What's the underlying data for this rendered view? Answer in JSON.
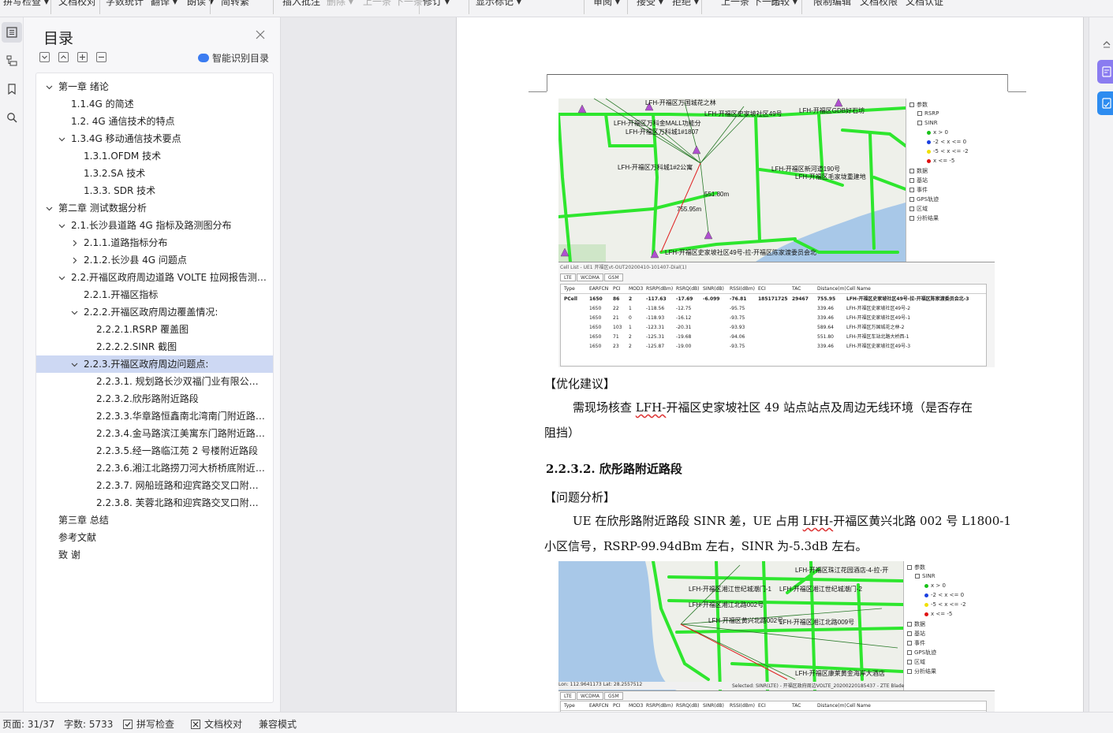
{
  "ribbon": {
    "items": [
      {
        "label": "拼写检查 ▾",
        "dim": false
      },
      {
        "label": "文档校对",
        "dim": false
      },
      {
        "label": "字数统计",
        "dim": false
      },
      {
        "label": "翻译 ▾",
        "dim": false
      },
      {
        "label": "朗读 ▾",
        "dim": false
      },
      {
        "label": "简转繁",
        "dim": false
      },
      {
        "label": "插入批注",
        "dim": false
      },
      {
        "label": "删除 ▾",
        "dim": true
      },
      {
        "label": "上一条",
        "dim": true
      },
      {
        "label": "下一条",
        "dim": true
      },
      {
        "label": "修订 ▾",
        "dim": false
      },
      {
        "label": "显示标记 ▾",
        "dim": false
      },
      {
        "label": "审阅 ▾",
        "dim": false
      },
      {
        "label": "接受 ▾",
        "dim": false
      },
      {
        "label": "拒绝 ▾",
        "dim": false
      },
      {
        "label": "上一条",
        "dim": false
      },
      {
        "label": "下一条",
        "dim": false
      },
      {
        "label": "比较 ▾",
        "dim": false
      },
      {
        "label": "限制编辑",
        "dim": false
      },
      {
        "label": "文档权限",
        "dim": false
      },
      {
        "label": "文档认证",
        "dim": false
      }
    ]
  },
  "rail": {
    "icons": [
      "toc-icon",
      "outline-icon",
      "bookmark-icon",
      "find-icon"
    ]
  },
  "toc": {
    "title": "目录",
    "smart_label": "智能识别目录",
    "items": [
      {
        "text": "第一章  绪论",
        "level": 0,
        "arrow": "down"
      },
      {
        "text": "1.1.4G 的简述",
        "level": 1,
        "arrow": ""
      },
      {
        "text": "1.2.  4G 通信技术的特点",
        "level": 1,
        "arrow": ""
      },
      {
        "text": "1.3.4G 移动通信技术要点",
        "level": 1,
        "arrow": "down"
      },
      {
        "text": "1.3.1.OFDM 技术",
        "level": 2,
        "arrow": ""
      },
      {
        "text": "1.3.2.SA 技术",
        "level": 2,
        "arrow": ""
      },
      {
        "text": "1.3.3.  SDR 技术",
        "level": 2,
        "arrow": ""
      },
      {
        "text": "第二章  测试数据分析",
        "level": 0,
        "arrow": "down"
      },
      {
        "text": "2.1.长沙县道路 4G 指标及路测图分布",
        "level": 1,
        "arrow": "down"
      },
      {
        "text": "2.1.1.道路指标分布",
        "level": 2,
        "arrow": "right"
      },
      {
        "text": "2.1.2.长沙县 4G 问题点",
        "level": 2,
        "arrow": "right"
      },
      {
        "text": "2.2.开福区政府周边道路 VOLTE 拉网报告测试...",
        "level": 1,
        "arrow": "down"
      },
      {
        "text": "2.2.1.开福区指标",
        "level": 2,
        "arrow": ""
      },
      {
        "text": "2.2.2.开福区政府周边覆盖情况:",
        "level": 2,
        "arrow": "down"
      },
      {
        "text": "2.2.2.1.RSRP 覆盖图",
        "level": 3,
        "arrow": ""
      },
      {
        "text": "2.2.2.2.SINR 截图",
        "level": 3,
        "arrow": ""
      },
      {
        "text": "2.2.3.开福区政府周边问题点:",
        "level": 2,
        "arrow": "down",
        "selected": true
      },
      {
        "text": "2.2.3.1.  规划路长沙双福门业有限公司...",
        "level": 3,
        "arrow": ""
      },
      {
        "text": "2.2.3.2.欣彤路附近路段",
        "level": 3,
        "arrow": ""
      },
      {
        "text": "2.2.3.3.华章路恒鑫南北湾南门附近路段...",
        "level": 3,
        "arrow": ""
      },
      {
        "text": "2.2.3.4.金马路滨江美寓东门路附近路段...",
        "level": 3,
        "arrow": ""
      },
      {
        "text": "2.2.3.5.经一路临江苑 2 号楼附近路段",
        "level": 3,
        "arrow": ""
      },
      {
        "text": "2.2.3.6.湘江北路捞刀河大桥桥底附近路段...",
        "level": 3,
        "arrow": ""
      },
      {
        "text": "2.2.3.7.  网船班路和迎宾路交叉口附近路段...",
        "level": 3,
        "arrow": ""
      },
      {
        "text": "2.2.3.8.  芙蓉北路和迎宾路交叉口附近路段...",
        "level": 3,
        "arrow": ""
      },
      {
        "text": "第三章  总结",
        "level": 0,
        "arrow": ""
      },
      {
        "text": "参考文献",
        "level": 0,
        "arrow": ""
      },
      {
        "text": "致    谢",
        "level": 0,
        "arrow": ""
      }
    ]
  },
  "doc": {
    "section_label": "【优化建议】",
    "suggestion_line1_pre": "需现场核查",
    "suggestion_line1_underline": "LFH-",
    "suggestion_line1_post": "开福区史家坡社区 49 站点站点及周边无线环境（是否存在",
    "suggestion_line2": "阻挡）",
    "heading": "2.2.3.2.   欣彤路附近路段",
    "analysis_label": "【问题分析】",
    "analysis_line1_pre": "UE 在欣彤路附近路段 SINR 差，UE 占用 ",
    "analysis_line1_underline": "LFH-",
    "analysis_line1_post": "开福区黄兴北路 002 号 L1800-1",
    "analysis_line2": "小区信号，RSRP-99.94dBm 左右，SINR 为-5.3dB 左右。"
  },
  "figure1": {
    "map_labels": [
      "LFH-开福区万国城花之林",
      "LFH-开福区史家坡社区49号",
      "LFH-开福区GDB好石坊",
      "LFH-开福区万科金MALL功能分",
      "LFH-开福区万科城1#1807",
      "LFH-开福区万科城1#2公寓",
      "LFH-开福区新河道190号",
      "LFH-开福区毛家垅重建地",
      "LFH-开福区史家坡社区49号-拉-开福区陈家渡委员会北",
      "755.95m",
      "551.80m"
    ],
    "legend": {
      "root": "参数",
      "items": [
        "RSRP",
        "SINR"
      ],
      "ranges": [
        {
          "label": "x > 0",
          "color": "#19c219"
        },
        {
          "label": "-2 < x <= 0",
          "color": "#1a3fe0"
        },
        {
          "label": "-5 < x <= -2",
          "color": "#f0e000"
        },
        {
          "label": "x <= -5",
          "color": "#e01010"
        }
      ],
      "groups": [
        "数据",
        "基站",
        "事件",
        "GPS轨迹",
        "区域",
        "分析结果"
      ]
    },
    "panel_title": "Cell List - UE1 开福区vt-OUT20200410-101407-Dial(1)",
    "tabs": [
      "LTE",
      "WCDMA",
      "GSM"
    ],
    "columns": [
      "Type",
      "EARFCN",
      "PCI",
      "MOD3",
      "RSRP(dBm)",
      "RSRQ(dB)",
      "SINR(dB)",
      "RSSI(dBm)",
      "ECI",
      "TAC",
      "Distance(m)",
      "Cell Name"
    ],
    "rows": [
      [
        "PCell",
        "1650",
        "86",
        "2",
        "-117.63",
        "-17.69",
        "-6.099",
        "-76.81",
        "185171725",
        "29467",
        "755.95",
        "LFH-开福区史家坡社区49号-拉-开福区陈家渡委员会北-3"
      ],
      [
        "",
        "1650",
        "22",
        "1",
        "-118.56",
        "-12.75",
        "",
        "-95.75",
        "",
        "",
        "339.46",
        "LFH-开福区史家坡社区49号-2"
      ],
      [
        "",
        "1650",
        "21",
        "0",
        "-118.93",
        "-16.12",
        "",
        "-93.75",
        "",
        "",
        "339.46",
        "LFH-开福区史家坡社区49号-1"
      ],
      [
        "",
        "1650",
        "103",
        "1",
        "-123.31",
        "-20.31",
        "",
        "-93.93",
        "",
        "",
        "589.64",
        "LFH-开福区万国城花之林-2"
      ],
      [
        "",
        "1650",
        "71",
        "2",
        "-125.31",
        "-19.68",
        "",
        "-94.06",
        "",
        "",
        "551.80",
        "LFH-开福区车站北路大桥西-1"
      ],
      [
        "",
        "1650",
        "23",
        "2",
        "-125.87",
        "-19.00",
        "",
        "-93.75",
        "",
        "",
        "339.46",
        "LFH-开福区史家坡社区49号-3"
      ]
    ]
  },
  "figure2": {
    "map_labels": [
      "LFH-开福区珠江花园酒店-4-拉-开",
      "LFH-开福区湘江世纪城潮门-1",
      "LFH-开福区湘江世纪城潮门-2",
      "LFH-开福区湘江北路002号",
      "LFH-开福区黄兴北路002号",
      "LFH-开福区湘江北路009号",
      "LFH-开福区康莱黄金海岸大酒店"
    ],
    "legend": {
      "root": "参数",
      "items": [
        "SINR"
      ],
      "ranges": [
        {
          "label": "x > 0",
          "color": "#19c219"
        },
        {
          "label": "-2 < x <= 0",
          "color": "#1a3fe0"
        },
        {
          "label": "-5 < x <= -2",
          "color": "#f0e000"
        },
        {
          "label": "x <= -5",
          "color": "#e01010"
        }
      ],
      "groups": [
        "数据",
        "基站",
        "事件",
        "GPS轨迹",
        "区域",
        "分析结果"
      ]
    },
    "status_text": "Lon:  112.9641173   Lat:  28.2557512",
    "selected_text": "Selected: SINR(LTE) - 开福区政府周边VOLTE_20200220185437 - ZTE Blade",
    "tabs": [
      "LTE",
      "WCDMA",
      "GSM"
    ],
    "columns": [
      "Type",
      "EARFCN",
      "PCI",
      "MOD3",
      "RSRP(dBm)",
      "RSRQ(dB)",
      "SINR(dB)",
      "RSSI(dBm)",
      "ECI",
      "TAC",
      "Distance(m)",
      "Cell Name"
    ]
  },
  "status": {
    "page": "页面: 31/37",
    "words": "字数: 5733",
    "spell": "拼写检查",
    "proof": "文档校对",
    "compat": "兼容模式"
  }
}
